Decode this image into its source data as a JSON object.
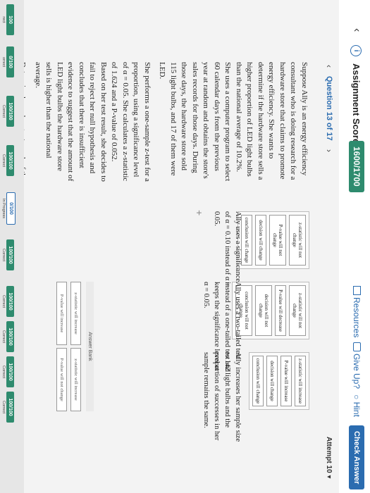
{
  "header": {
    "score_label": "Assignment Score:",
    "score_value": "1600/1700",
    "resources": "Resources",
    "give_up": "Give Up?",
    "hint": "Hint",
    "check_answer": "Check Answer"
  },
  "nav": {
    "question_title": "Question 13 of 17",
    "attempt": "Attempt 10"
  },
  "rail": [
    {
      "score": "100",
      "status": "rect"
    },
    {
      "score": "0/100",
      "status": "orrect"
    },
    {
      "score": "100/100",
      "status": "Correct"
    },
    {
      "score": "100/100",
      "status": "Correct"
    },
    {
      "score": "0/100",
      "status": "In Progress"
    },
    {
      "score": "100/100",
      "status": "Correct"
    },
    {
      "score": "100/100",
      "status": "Correct"
    },
    {
      "score": "100/100",
      "status": "Correct"
    },
    {
      "score": "100/100",
      "status": "Correct"
    },
    {
      "score": "100/100",
      "status": "Correct"
    }
  ],
  "question": {
    "p1": "Suppose Ally is an energy efficiency consultant who is doing research for a hardware store that claims to promote energy efficiency. She wants to determine if the hardware store sells a higher proportion of LED light bulbs than the national average of 10.2%. She uses a computer program to select 60 calendar days from the previous year at random and obtains the store's sales records for those days. During those days, the hardware store sold 115 light bulbs, and 17 of them were LED.",
    "p2": "She performs a one-sample z-test for a proportion, using a significance level of α = 0.05. She calculates a z-statistic of 1.624 and a P-value of 0.052. Based on her test result, she decides to fail to reject her null hypothesis and concludes that there is insufficient evidence to suggest that the amount of LED light bulbs the hardware store sells is higher than the national average.",
    "p3": "Determine how changes to each of the"
  },
  "scenarios": [
    {
      "text": "Ally uses a significance level of α = 0.10 instead of α = 0.05.",
      "chips": [
        "z-statistic will not change",
        "P-value will not change",
        "decision will change",
        "conclusion will change"
      ]
    },
    {
      "text": "Ally uses a two-tailed test instead of a one-tailed test and keeps the significance level at α = 0.05.",
      "chips": [
        "z-statistic will not change",
        "P-value will decrease",
        "decision will not change",
        "conclusion will not change"
      ]
    },
    {
      "text": "Ally increases her sample size to 142 light bulbs and the proportion of successes in her sample remains the same.",
      "chips": [
        "z-statistic will increase",
        "P-value will increase",
        "decision will change",
        "conclusion will change"
      ]
    }
  ],
  "bank": {
    "label": "Answer Bank",
    "items": [
      "z-statistic will increase",
      "z-statistic will increase",
      "P-value will increase",
      "P-value will not change"
    ]
  }
}
